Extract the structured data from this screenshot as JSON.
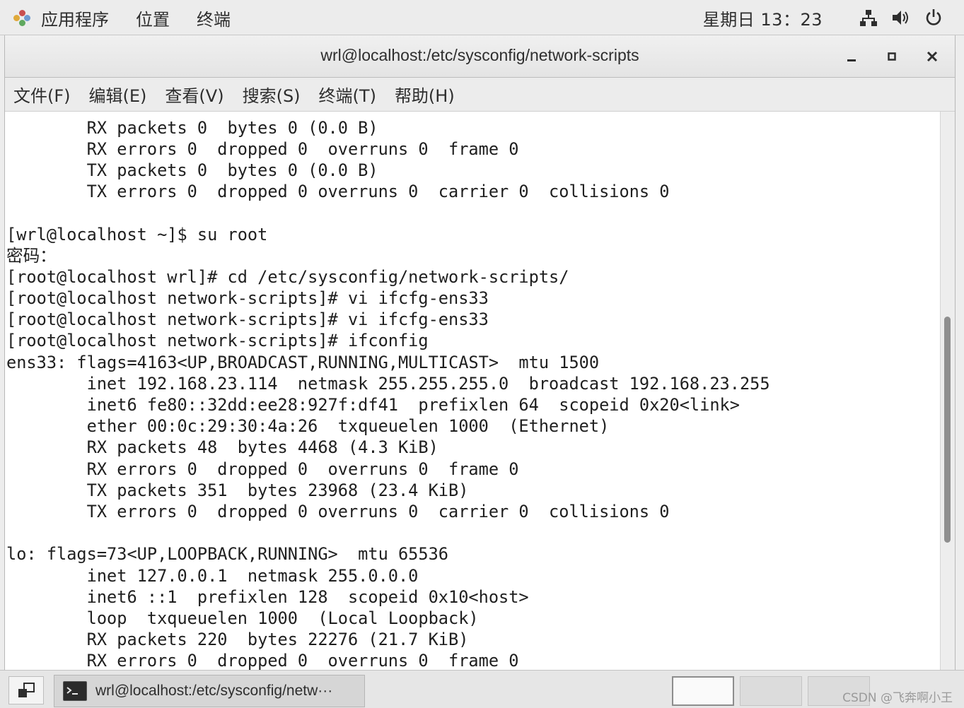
{
  "topbar": {
    "menus": [
      "应用程序",
      "位置",
      "终端"
    ],
    "clock": "星期日 13：23"
  },
  "window": {
    "title": "wrl@localhost:/etc/sysconfig/network-scripts",
    "menu": [
      "文件(F)",
      "编辑(E)",
      "查看(V)",
      "搜索(S)",
      "终端(T)",
      "帮助(H)"
    ]
  },
  "terminal": {
    "lines": [
      "        RX packets 0  bytes 0 (0.0 B)",
      "        RX errors 0  dropped 0  overruns 0  frame 0",
      "        TX packets 0  bytes 0 (0.0 B)",
      "        TX errors 0  dropped 0 overruns 0  carrier 0  collisions 0",
      "",
      "[wrl@localhost ~]$ su root",
      "密码：",
      "[root@localhost wrl]# cd /etc/sysconfig/network-scripts/",
      "[root@localhost network-scripts]# vi ifcfg-ens33",
      "[root@localhost network-scripts]# vi ifcfg-ens33",
      "[root@localhost network-scripts]# ifconfig",
      "ens33: flags=4163<UP,BROADCAST,RUNNING,MULTICAST>  mtu 1500",
      "        inet 192.168.23.114  netmask 255.255.255.0  broadcast 192.168.23.255",
      "        inet6 fe80::32dd:ee28:927f:df41  prefixlen 64  scopeid 0x20<link>",
      "        ether 00:0c:29:30:4a:26  txqueuelen 1000  (Ethernet)",
      "        RX packets 48  bytes 4468 (4.3 KiB)",
      "        RX errors 0  dropped 0  overruns 0  frame 0",
      "        TX packets 351  bytes 23968 (23.4 KiB)",
      "        TX errors 0  dropped 0 overruns 0  carrier 0  collisions 0",
      "",
      "lo: flags=73<UP,LOOPBACK,RUNNING>  mtu 65536",
      "        inet 127.0.0.1  netmask 255.0.0.0",
      "        inet6 ::1  prefixlen 128  scopeid 0x10<host>",
      "        loop  txqueuelen 1000  (Local Loopback)",
      "        RX packets 220  bytes 22276 (21.7 KiB)",
      "        RX errors 0  dropped 0  overruns 0  frame 0"
    ]
  },
  "taskbar": {
    "task_label": "wrl@localhost:/etc/sysconfig/netw···",
    "watermark": "CSDN @飞奔啊小王"
  },
  "icons": {
    "apps": "gnome-foot-icon",
    "network": "network-icon",
    "volume": "volume-icon",
    "power": "power-icon",
    "minimize": "minimize-icon",
    "maximize": "maximize-icon",
    "close": "close-icon",
    "show_desktop": "show-desktop-icon",
    "terminal": "terminal-icon"
  }
}
